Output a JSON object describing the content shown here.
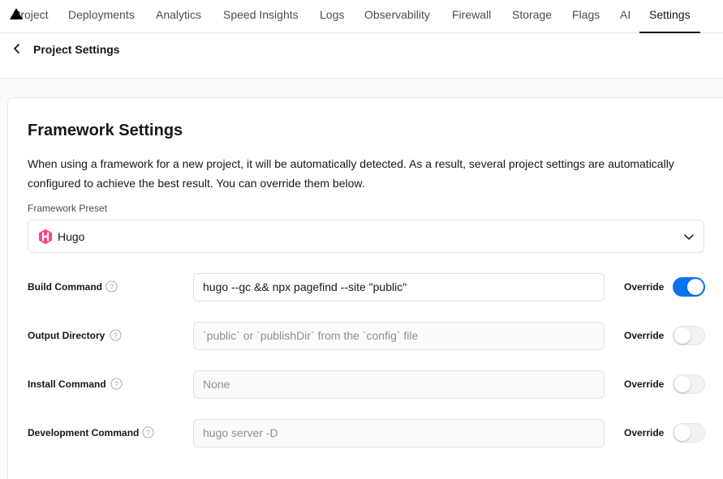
{
  "nav": {
    "items": [
      {
        "label": "Project"
      },
      {
        "label": "Deployments"
      },
      {
        "label": "Analytics"
      },
      {
        "label": "Speed Insights"
      },
      {
        "label": "Logs"
      },
      {
        "label": "Observability"
      },
      {
        "label": "Firewall"
      },
      {
        "label": "Storage"
      },
      {
        "label": "Flags"
      },
      {
        "label": "AI"
      },
      {
        "label": "Settings"
      }
    ],
    "active": "Settings"
  },
  "subheader": {
    "title": "Project Settings"
  },
  "framework": {
    "title": "Framework Settings",
    "description": "When using a framework for a new project, it will be automatically detected. As a result, several project settings are automatically configured to achieve the best result. You can override them below.",
    "preset_label": "Framework Preset",
    "preset_value": "Hugo",
    "preset_icon": "hugo-logo-icon",
    "rows": [
      {
        "label": "Build Command",
        "value": "hugo --gc && npx pagefind --site \"public\"",
        "placeholder": "",
        "override_label": "Override",
        "override_on": true
      },
      {
        "label": "Output Directory",
        "value": "",
        "placeholder": "`public` or `publishDir` from the `config` file",
        "override_label": "Override",
        "override_on": false
      },
      {
        "label": "Install Command",
        "value": "",
        "placeholder": "None",
        "override_label": "Override",
        "override_on": false
      },
      {
        "label": "Development Command",
        "value": "",
        "placeholder": "hugo server -D",
        "override_label": "Override",
        "override_on": false
      }
    ]
  },
  "colors": {
    "accent": "#0a72ef",
    "hugo": "#ff4088"
  }
}
